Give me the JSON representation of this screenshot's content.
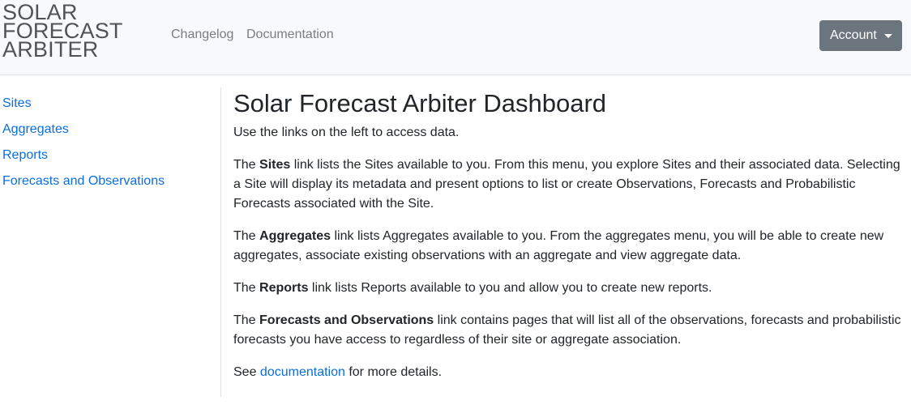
{
  "navbar": {
    "brand_lines": [
      "SOLAR",
      "FORECAST",
      "ARBITER"
    ],
    "links": [
      "Changelog",
      "Documentation"
    ],
    "account_label": "Account",
    "account_icon": "caret-down-icon"
  },
  "sidebar": {
    "items": [
      {
        "label": "Sites"
      },
      {
        "label": "Aggregates"
      },
      {
        "label": "Reports"
      },
      {
        "label": "Forecasts and Observations"
      }
    ]
  },
  "main": {
    "title": "Solar Forecast Arbiter Dashboard",
    "intro": "Use the links on the left to access data.",
    "sites": {
      "pre": "The ",
      "bold": "Sites",
      "post": " link lists the Sites available to you. From this menu, you explore Sites and their associated data. Selecting a Site will display its metadata and present options to list or create Observations, Forecasts and Probabilistic Forecasts associated with the Site."
    },
    "aggregates": {
      "pre": "The ",
      "bold": "Aggregates",
      "post": " link lists Aggregates available to you. From the aggregates menu, you will be able to create new aggregates, associate existing observations with an aggregate and view aggregate data."
    },
    "reports": {
      "pre": "The ",
      "bold": "Reports",
      "post": " link lists Reports available to you and allow you to create new reports."
    },
    "forecasts": {
      "pre": "The ",
      "bold": "Forecasts and Observations",
      "post": " link contains pages that will list all of the observations, forecasts and probabilistic forecasts you have access to regardless of their site or aggregate association."
    },
    "see": {
      "pre": "See ",
      "link": "documentation",
      "post": " for more details."
    }
  },
  "colors": {
    "link": "#0a6ede",
    "navbar_bg": "#f8f9fa",
    "button_bg": "#6c757d",
    "text": "#212529"
  }
}
